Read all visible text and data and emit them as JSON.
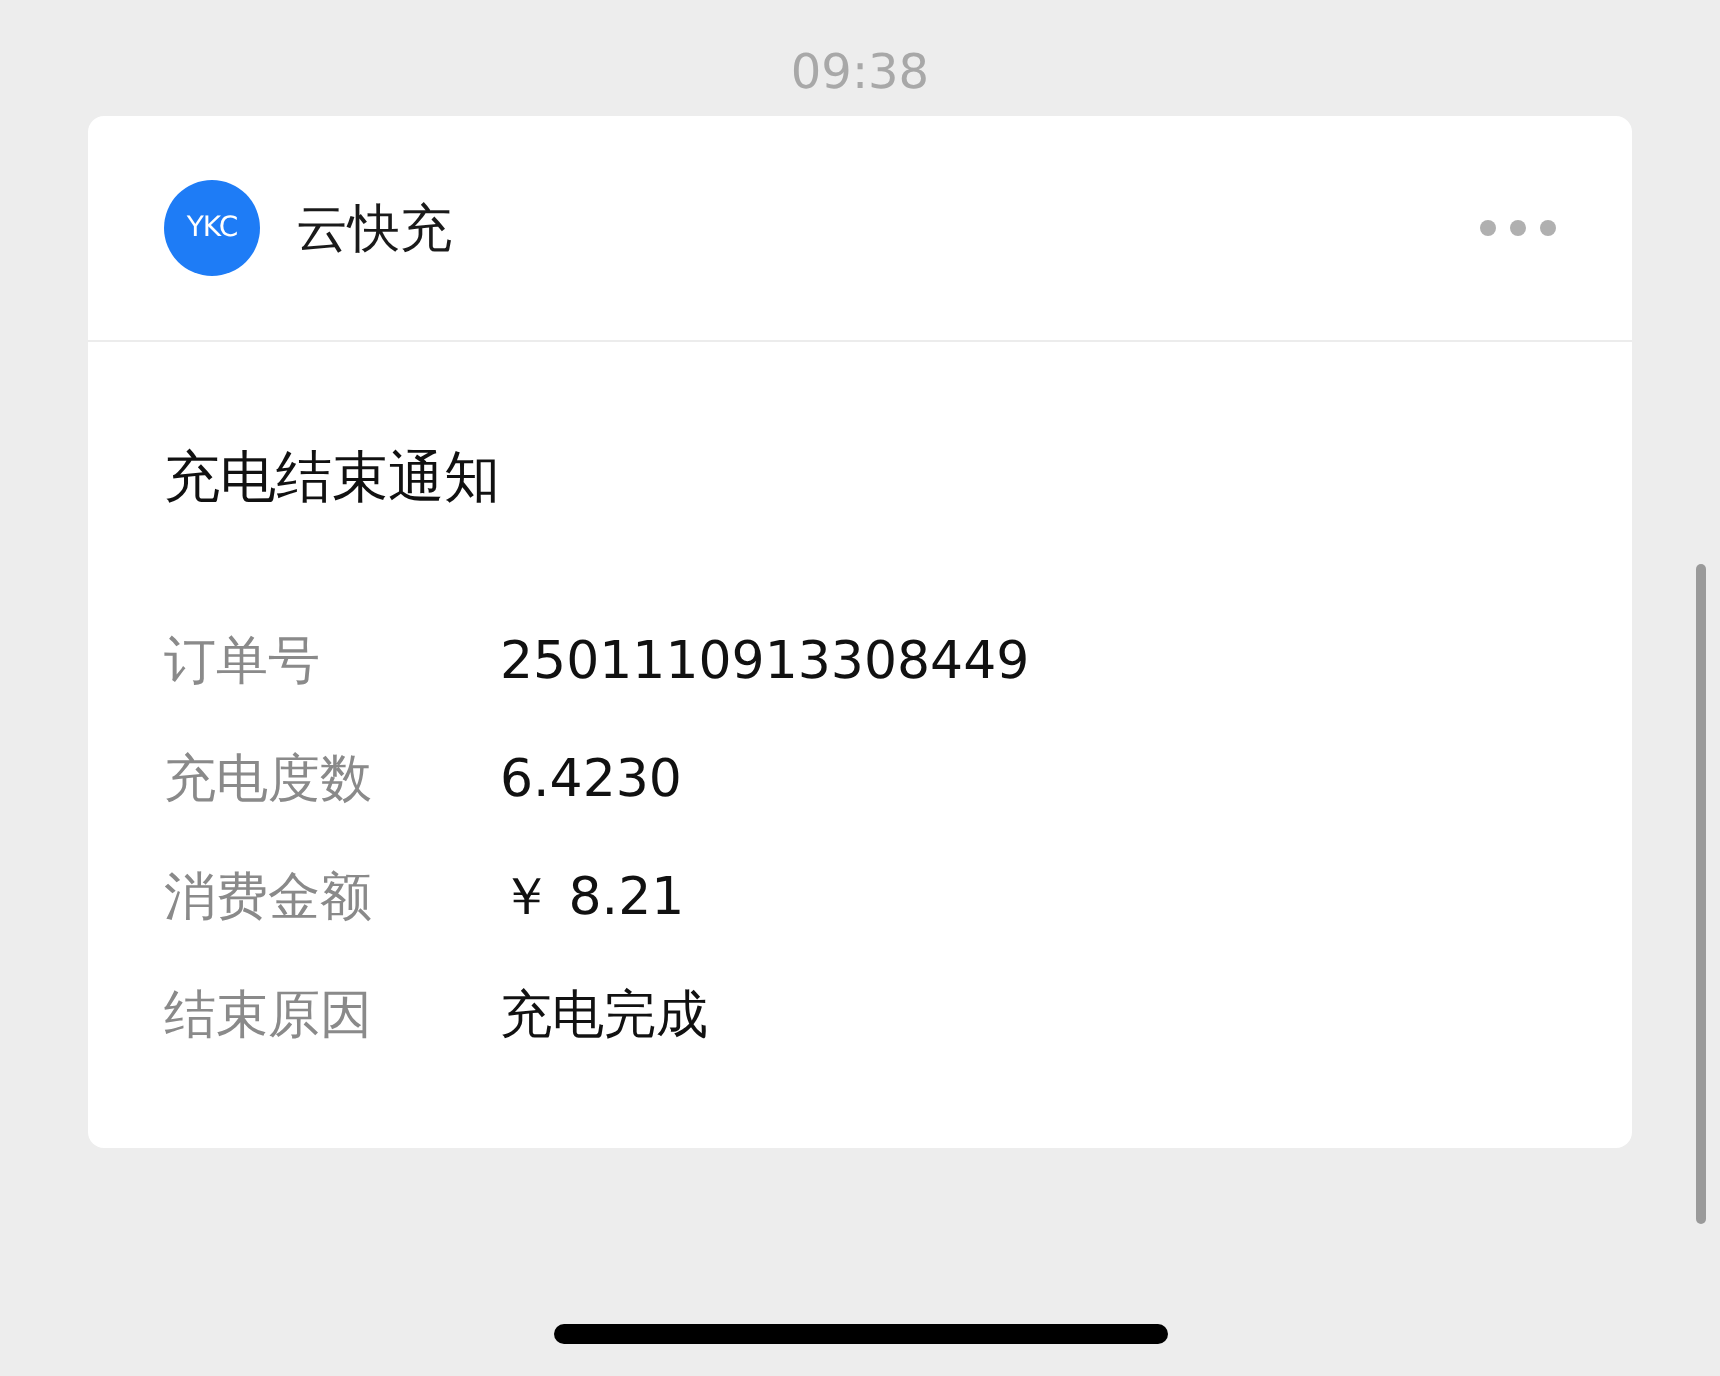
{
  "time": "09:38",
  "card": {
    "account": {
      "logo": "YKC",
      "name": "云快充"
    },
    "title": "充电结束通知",
    "fields": [
      {
        "label": "订单号",
        "value": "2501110913308449"
      },
      {
        "label": "充电度数",
        "value": "6.4230"
      },
      {
        "label": "消费金额",
        "value": "￥ 8.21"
      },
      {
        "label": "结束原因",
        "value": "充电完成"
      }
    ]
  }
}
